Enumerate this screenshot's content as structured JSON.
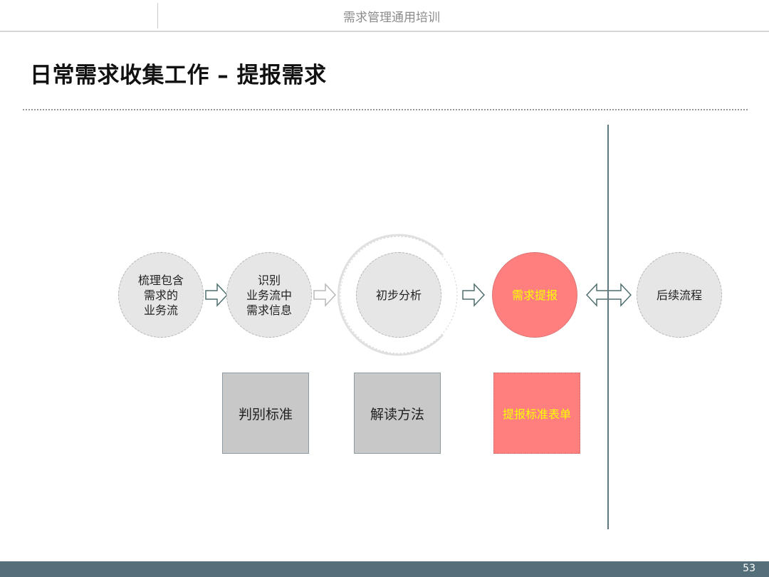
{
  "header": {
    "title": "需求管理通用培训"
  },
  "page_title": "日常需求收集工作 – 提报需求",
  "flow": {
    "steps": [
      {
        "label": "梳理包含\n需求的\n业务流"
      },
      {
        "label": "识别\n业务流中\n需求信息"
      },
      {
        "label": "初步分析"
      },
      {
        "label": "需求提报"
      },
      {
        "label": "后续流程"
      }
    ]
  },
  "boxes": [
    {
      "label": "判别标准"
    },
    {
      "label": "解读方法"
    },
    {
      "label": "提报标准表单"
    }
  ],
  "colors": {
    "highlight_fill": "#ff7f7f",
    "highlight_text": "#ffff00",
    "neutral_fill": "#e6e6e6",
    "footer": "#546f7a"
  },
  "footer": {
    "page_number": "53"
  }
}
